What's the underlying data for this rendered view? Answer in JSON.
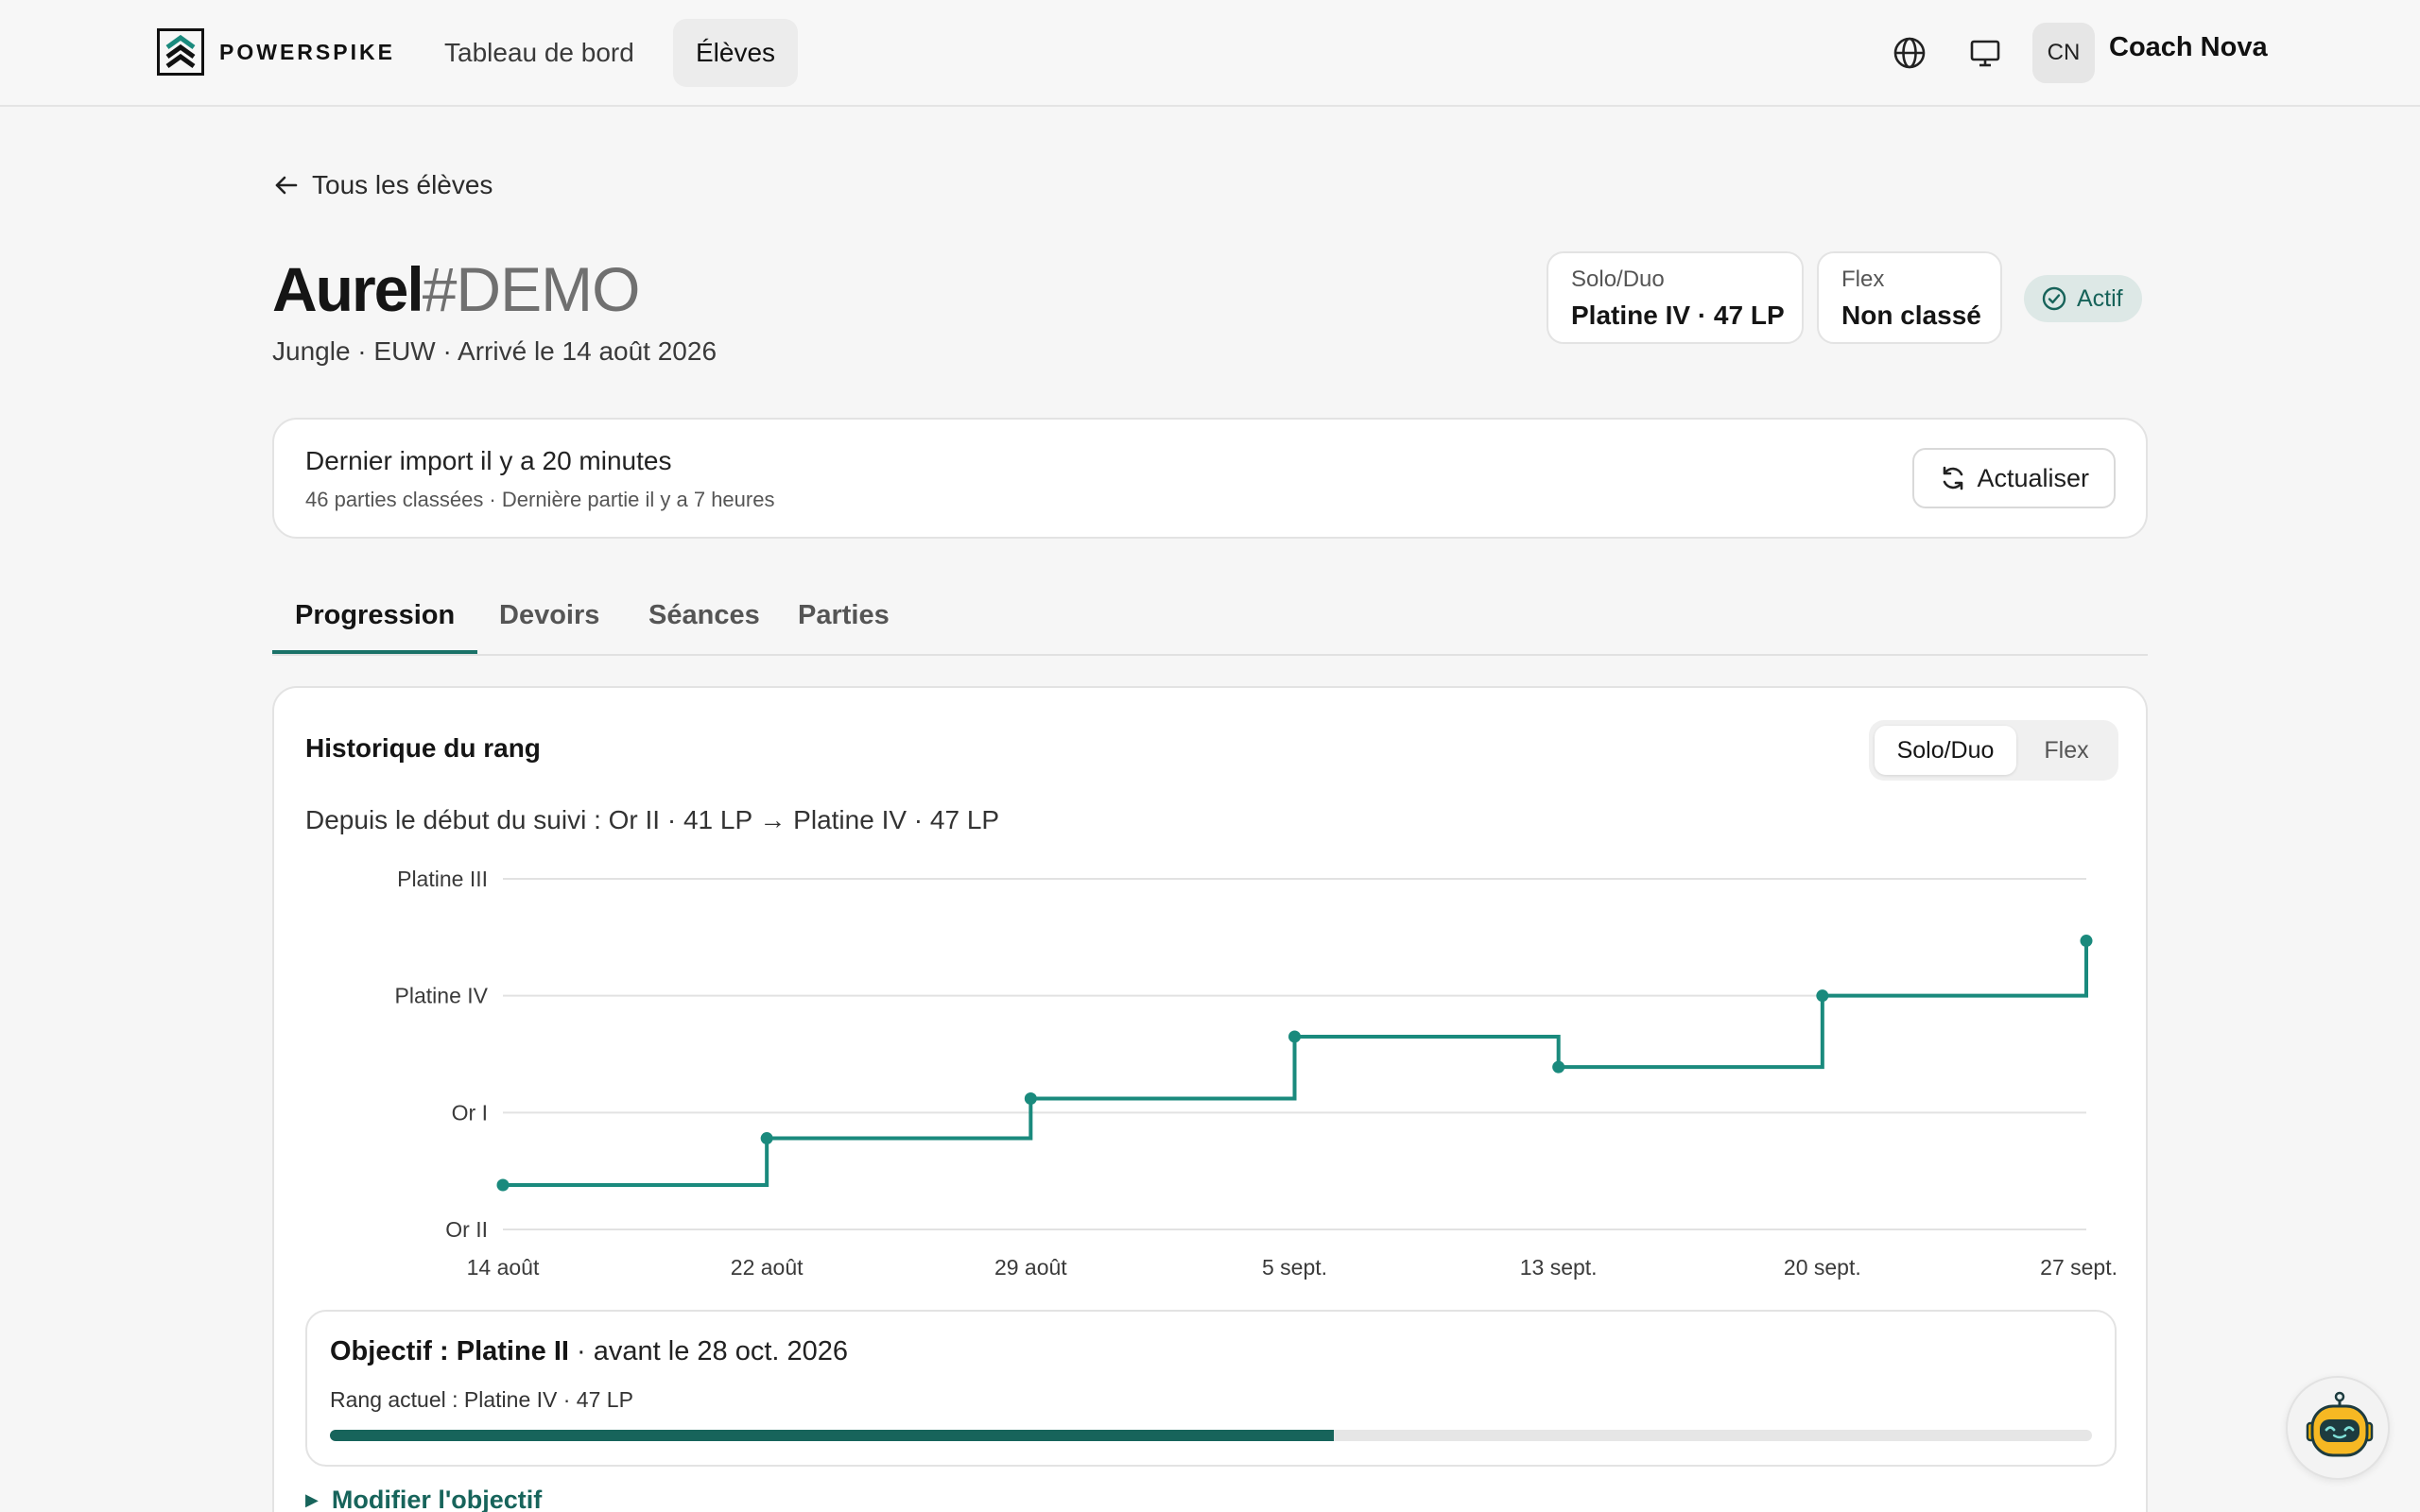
{
  "nav": {
    "brand": "POWERSPIKE",
    "links": [
      "Tableau de bord",
      "Élèves"
    ],
    "active_link": "Élèves",
    "user_initials": "CN",
    "user_name": "Coach Nova"
  },
  "header": {
    "back_label": "Tous les élèves",
    "player_name": "Aurel",
    "player_tag": "#DEMO",
    "subtitle": "Jungle · EUW · Arrivé le 14 août 2026",
    "ranks": [
      {
        "label": "Solo/Duo",
        "value": "Platine IV · 47 LP"
      },
      {
        "label": "Flex",
        "value": "Non classé"
      }
    ],
    "status": "Actif"
  },
  "import": {
    "title": "Dernier import il y a 20 minutes",
    "subtitle": "46 parties classées · Dernière partie il y a 7 heures",
    "refresh_label": "Actualiser"
  },
  "tabs": [
    "Progression",
    "Devoirs",
    "Séances",
    "Parties"
  ],
  "active_tab": "Progression",
  "rank_history": {
    "title": "Historique du rang",
    "queue_options": [
      "Solo/Duo",
      "Flex"
    ],
    "selected_queue": "Solo/Duo",
    "summary": "Depuis le début du suivi : Or II · 41 LP → Platine IV · 47 LP"
  },
  "chart_data": {
    "type": "line",
    "step": true,
    "x": [
      "14 août",
      "22 août",
      "29 août",
      "5 sept.",
      "13 sept.",
      "20 sept.",
      "27 sept."
    ],
    "y_ticks": [
      "Or II",
      "Or I",
      "Platine IV",
      "Platine III"
    ],
    "series": [
      {
        "values": [
          0.38,
          0.78,
          1.12,
          1.65,
          1.39,
          2.0,
          2.47
        ],
        "color": "#1a8a7d"
      }
    ],
    "ylim": [
      0,
      3
    ],
    "grid": true
  },
  "goal": {
    "label": "Objectif : Platine II",
    "deadline": " · avant le 28 oct. 2026",
    "current": "Rang actuel : Platine IV · 47 LP",
    "progress": 0.57,
    "edit_label": "Modifier l'objectif"
  },
  "colors": {
    "accent": "#1a8a7d",
    "accent_dark": "#17645b",
    "badge_bg": "#dde8e6"
  }
}
